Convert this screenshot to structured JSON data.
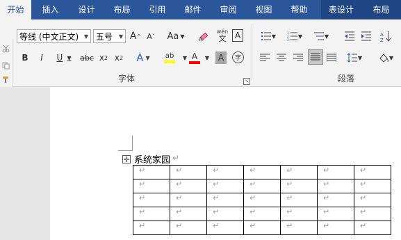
{
  "tabs": [
    {
      "label": "开始",
      "state": "active"
    },
    {
      "label": "插入",
      "state": "normal"
    },
    {
      "label": "设计",
      "state": "normal"
    },
    {
      "label": "布局",
      "state": "normal"
    },
    {
      "label": "引用",
      "state": "normal"
    },
    {
      "label": "邮件",
      "state": "normal"
    },
    {
      "label": "审阅",
      "state": "normal"
    },
    {
      "label": "视图",
      "state": "normal"
    },
    {
      "label": "帮助",
      "state": "normal"
    },
    {
      "label": "表设计",
      "state": "contextual"
    },
    {
      "label": "布局",
      "state": "contextual"
    }
  ],
  "font": {
    "name_value": "等线 (中文正文)",
    "size_value": "五号",
    "grow_label": "A",
    "shrink_label": "A",
    "case_label": "Aa",
    "phonetic_top": "wén",
    "phonetic_bottom": "文",
    "border_char": "A",
    "bold": "B",
    "italic": "I",
    "underline": "U",
    "strike": "abc",
    "subscript": "x",
    "sub_mark": "2",
    "superscript": "x",
    "sup_mark": "2",
    "effects": "A",
    "highlight": "ab",
    "color": "A",
    "shading": "A",
    "enclose": "字",
    "group_label": "字体"
  },
  "paragraph": {
    "group_label": "段落"
  },
  "colors": {
    "tab_bar": "#2b579a",
    "highlight": "#ffff00",
    "font_color": "#ff0000"
  },
  "document": {
    "table_title": "系统家园",
    "paragraph_mark": "↵",
    "move_handle": "✛",
    "table": {
      "rows": [
        [
          "↵",
          "↵",
          "↵",
          "↵",
          "↵",
          "↵",
          "↵"
        ],
        [
          "↵",
          "↵",
          "↵",
          "↵",
          "↵",
          "↵",
          "↵"
        ],
        [
          "↵",
          "↵",
          "↵",
          "↵",
          "↵",
          "↵",
          "↵"
        ],
        [
          "↵",
          "↵",
          "↵",
          "↵",
          "↵",
          "↵",
          "↵"
        ],
        [
          "↵",
          "↵",
          "↵",
          "↵",
          "↵",
          "↵",
          "↵"
        ]
      ]
    }
  }
}
